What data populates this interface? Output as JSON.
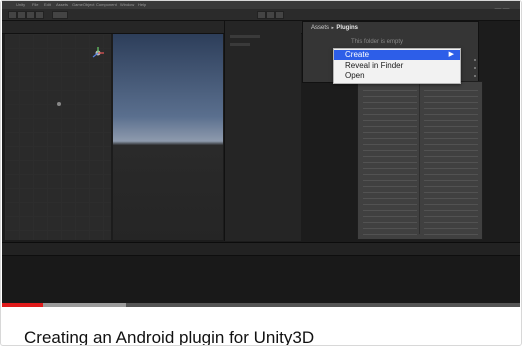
{
  "video": {
    "unity_menubar": [
      "Unity",
      "File",
      "Edit",
      "Assets",
      "GameObject",
      "Component",
      "Window",
      "Help"
    ],
    "project_panel": {
      "breadcrumb_root": "Assets",
      "breadcrumb_sep": "►",
      "breadcrumb_current": "Plugins",
      "empty_message": "This folder is empty"
    },
    "context_menu": {
      "items": [
        {
          "label": "Create",
          "selected": true,
          "has_submenu": true,
          "arrow": "▶"
        },
        {
          "label": "Reveal in Finder",
          "selected": false,
          "has_submenu": false,
          "arrow": ""
        },
        {
          "label": "Open",
          "selected": false,
          "has_submenu": false,
          "arrow": ""
        }
      ]
    },
    "progress": {
      "played_fraction": 0.08,
      "loaded_fraction": 0.24
    },
    "colors": {
      "played": "#e01b1b",
      "selection": "#2d5ee8"
    }
  },
  "title": "Creating an Android plugin for Unity3D"
}
